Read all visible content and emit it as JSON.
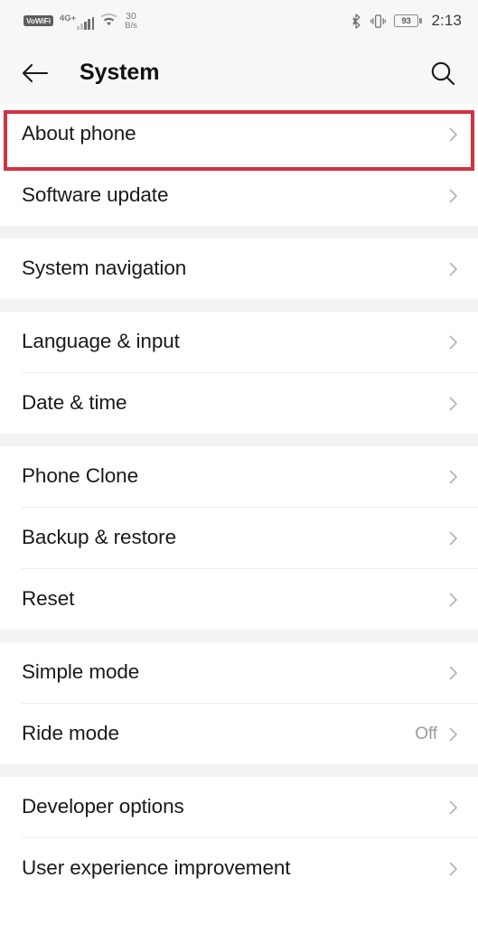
{
  "status_bar": {
    "vowifi_badge": "VoWiFi",
    "network_type": "4G+",
    "signal_icon": "signal-bars-icon",
    "wifi_icon": "wifi-icon",
    "data_rate_value": "30",
    "data_rate_unit": "B/s",
    "bluetooth_icon": "bluetooth-icon",
    "vibrate_icon": "vibrate-icon",
    "battery_percent": "93",
    "time": "2:13"
  },
  "header": {
    "back_icon": "back-arrow-icon",
    "title": "System",
    "search_icon": "search-icon"
  },
  "colors": {
    "highlight": "#cf3440",
    "page_bg": "#ffffff",
    "group_gap": "#f2f2f2",
    "header_bg": "#f7f7f7",
    "divider": "#ededed",
    "label": "#1a1a1a",
    "value": "#9a9a9a"
  },
  "groups": [
    {
      "rows": [
        {
          "label": "About phone",
          "value": "",
          "highlighted": true
        },
        {
          "label": "Software update",
          "value": "",
          "highlighted": false
        }
      ]
    },
    {
      "rows": [
        {
          "label": "System navigation",
          "value": "",
          "highlighted": false
        }
      ]
    },
    {
      "rows": [
        {
          "label": "Language & input",
          "value": "",
          "highlighted": false
        },
        {
          "label": "Date & time",
          "value": "",
          "highlighted": false
        }
      ]
    },
    {
      "rows": [
        {
          "label": "Phone Clone",
          "value": "",
          "highlighted": false
        },
        {
          "label": "Backup & restore",
          "value": "",
          "highlighted": false
        },
        {
          "label": "Reset",
          "value": "",
          "highlighted": false
        }
      ]
    },
    {
      "rows": [
        {
          "label": "Simple mode",
          "value": "",
          "highlighted": false
        },
        {
          "label": "Ride mode",
          "value": "Off",
          "highlighted": false
        }
      ]
    },
    {
      "rows": [
        {
          "label": "Developer options",
          "value": "",
          "highlighted": false
        },
        {
          "label": "User experience improvement",
          "value": "",
          "highlighted": false
        }
      ]
    }
  ]
}
